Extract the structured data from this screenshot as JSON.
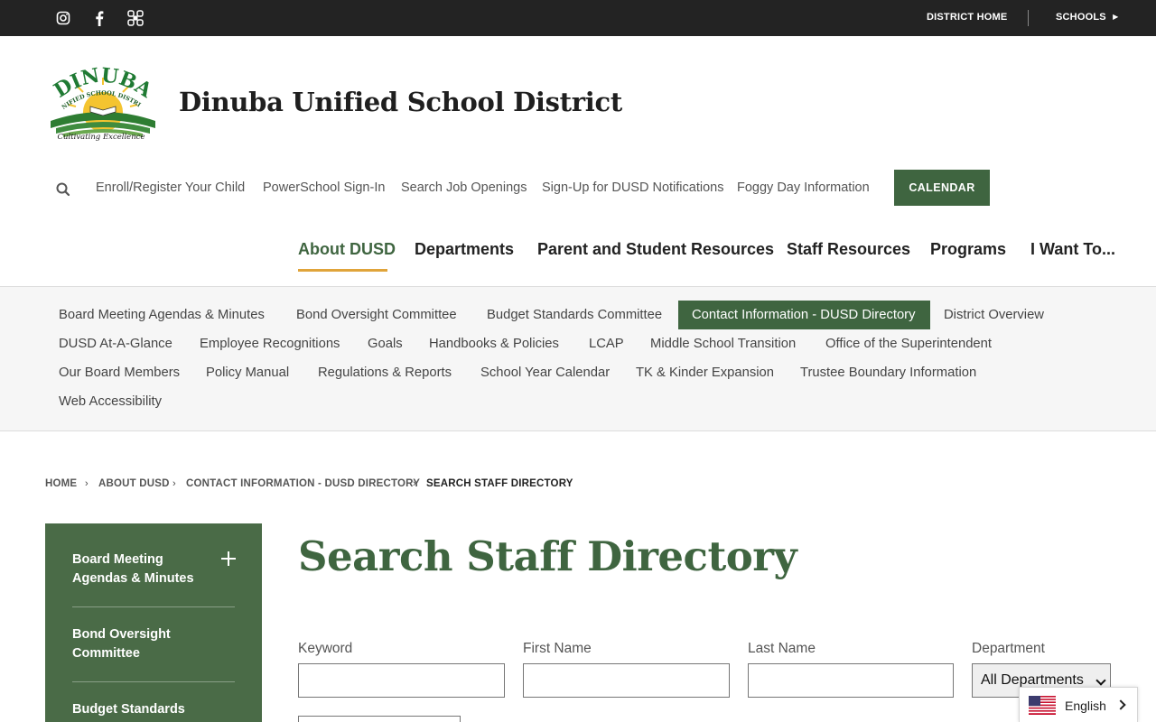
{
  "topbar": {
    "social": [
      {
        "icon": "instagram-icon"
      },
      {
        "icon": "facebook-icon"
      },
      {
        "icon": "app-icon"
      }
    ],
    "district_home": "DISTRICT HOME",
    "schools": "SCHOOLS"
  },
  "header": {
    "title": "Dinuba Unified School District",
    "logo": {
      "top_text": "DINUBA",
      "arc_text": "UNIFIED SCHOOL DISTRICT",
      "tagline": "Cultivating Excellence"
    }
  },
  "utility": {
    "links": [
      "Enroll/Register Your Child",
      "PowerSchool Sign-In",
      "Search Job Openings",
      "Sign-Up for DUSD Notifications",
      "Foggy Day Information"
    ],
    "calendar": "CALENDAR"
  },
  "mainnav": {
    "items": [
      "About DUSD",
      "Departments",
      "Parent and Student Resources",
      "Staff Resources",
      "Programs",
      "I Want To..."
    ],
    "active": "About DUSD"
  },
  "subnav": {
    "items": [
      "Board Meeting Agendas & Minutes",
      "Bond Oversight Committee",
      "Budget Standards Committee",
      "Contact Information - DUSD Directory",
      "District Overview",
      "DUSD At-A-Glance",
      "Employee Recognitions",
      "Goals",
      "Handbooks & Policies",
      "LCAP",
      "Middle School Transition",
      "Office of the Superintendent",
      "Our Board Members",
      "Policy Manual",
      "Regulations & Reports",
      "School Year Calendar",
      "TK & Kinder Expansion",
      "Trustee Boundary Information",
      "Web Accessibility"
    ],
    "active": "Contact Information - DUSD Directory"
  },
  "breadcrumb": {
    "items": [
      "HOME",
      "ABOUT DUSD",
      "CONTACT INFORMATION - DUSD DIRECTORY",
      "SEARCH STAFF DIRECTORY"
    ]
  },
  "sidebar": {
    "items": [
      "Board Meeting Agendas & Minutes",
      "Bond Oversight Committee",
      "Budget Standards"
    ]
  },
  "page": {
    "title": "Search Staff Directory"
  },
  "form": {
    "keyword_label": "Keyword",
    "first_name_label": "First Name",
    "last_name_label": "Last Name",
    "department_label": "Department",
    "department_selected": "All Departments",
    "keyword_value": "",
    "first_name_value": "",
    "last_name_value": ""
  },
  "language": {
    "name": "English",
    "icon": "us-flag-icon"
  },
  "colors": {
    "brand_green": "#3f6540",
    "sidebar_green": "#4a6b47",
    "accent_gold": "#e0a43a",
    "topbar": "#232323"
  }
}
